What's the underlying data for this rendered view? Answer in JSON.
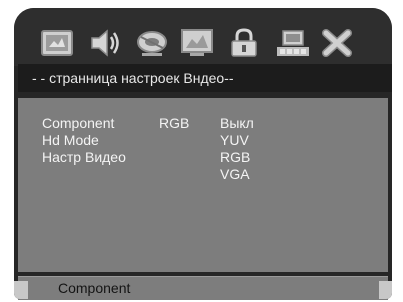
{
  "toolbar": {
    "icons": [
      "system-setup-icon",
      "audio-setup-icon",
      "video-setup-icon",
      "display-setup-icon",
      "parental-lock-icon",
      "preference-icon",
      "exit-icon"
    ],
    "selected_index": 2
  },
  "header": {
    "title": "- - странница  настроек Вндео--"
  },
  "menu": {
    "items": [
      "Component",
      "Hd Mode",
      "Настр Видео"
    ],
    "component_value": "RGB",
    "options": [
      "Выкл",
      "YUV",
      "RGB",
      "VGA"
    ]
  },
  "status": {
    "text": "Component"
  }
}
